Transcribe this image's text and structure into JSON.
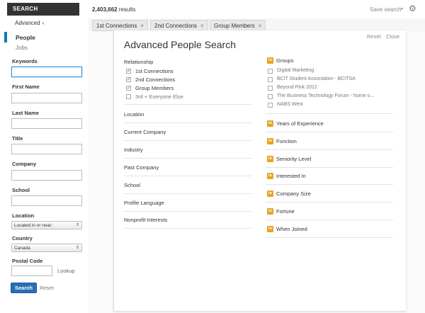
{
  "topbar": {
    "search_label": "SEARCH",
    "results_count": "2,403,662",
    "results_suffix": " results",
    "save_search": "Save search",
    "save_caret": "▾"
  },
  "leftnav": {
    "advanced": "Advanced",
    "people": "People",
    "jobs": "Jobs",
    "fields": {
      "keywords": "Keywords",
      "first_name": "First Name",
      "last_name": "Last Name",
      "title": "Title",
      "company": "Company",
      "school": "School",
      "location": "Location",
      "location_value": "Located in or near:",
      "country": "Country",
      "country_value": "Canada",
      "postal_code": "Postal Code",
      "lookup": "Lookup"
    },
    "search_button": "Search",
    "reset": "Reset"
  },
  "filter_tabs": [
    {
      "label": "1st Connections"
    },
    {
      "label": "2nd Connections"
    },
    {
      "label": "Group Members"
    }
  ],
  "panel": {
    "title": "Advanced People Search",
    "reset": "Reset",
    "close": "Close",
    "relationship_head": "Relationship",
    "relationship": [
      {
        "label": "1st Connections",
        "checked": true
      },
      {
        "label": "2nd Connections",
        "checked": true
      },
      {
        "label": "Group Members",
        "checked": true
      },
      {
        "label": "3rd + Everyone Else",
        "checked": false
      }
    ],
    "left_filters": [
      "Location",
      "Current Company",
      "Industry",
      "Past Company",
      "School",
      "Profile Language",
      "Nonprofit Interests"
    ],
    "groups_head": "Groups",
    "groups": [
      {
        "label": "Digital Marketing",
        "checked": false
      },
      {
        "label": "BCIT Student Association - BCITSA",
        "checked": false
      },
      {
        "label": "Beyond Pink 2012",
        "checked": false
      },
      {
        "label": "The Business Technology Forum - home o...",
        "checked": false
      },
      {
        "label": "NABS West",
        "checked": false
      }
    ],
    "right_filters": [
      "Years of Experience",
      "Function",
      "Seniority Level",
      "Interested In",
      "Company Size",
      "Fortune",
      "When Joined"
    ],
    "badge_text": "in"
  },
  "colors": {
    "accent_blue": "#0a79bf",
    "button_blue": "#2a6fb5",
    "premium_badge": "#e5a521"
  }
}
